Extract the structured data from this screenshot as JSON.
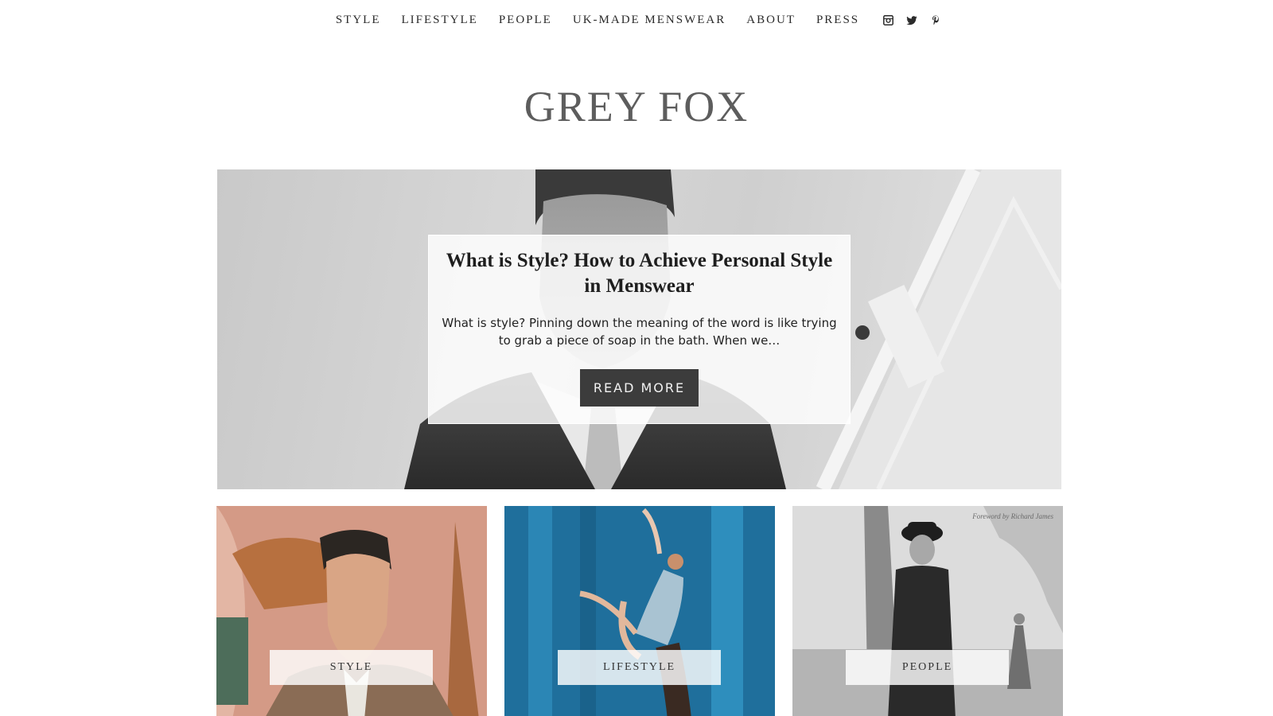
{
  "nav": {
    "items": [
      {
        "label": "STYLE"
      },
      {
        "label": "LIFESTYLE"
      },
      {
        "label": "PEOPLE"
      },
      {
        "label": "UK-MADE MENSWEAR"
      },
      {
        "label": "ABOUT"
      },
      {
        "label": "PRESS"
      }
    ],
    "social": [
      {
        "icon": "instagram-icon"
      },
      {
        "icon": "twitter-icon"
      },
      {
        "icon": "pinterest-icon"
      }
    ]
  },
  "site": {
    "logo": "GREY FOX"
  },
  "hero": {
    "title": "What is Style? How to Achieve Personal Style in Menswear",
    "excerpt": "What is style? Pinning down the meaning of the word is like trying to grab a piece of soap in the bath. When we…",
    "button_label": "READ MORE"
  },
  "tiles": [
    {
      "label": "STYLE"
    },
    {
      "label": "LIFESTYLE"
    },
    {
      "label": "PEOPLE",
      "caption": "Foreword by Richard James"
    }
  ],
  "colors": {
    "button_bg": "#3c3c3c",
    "logo": "#5d5d5d"
  }
}
